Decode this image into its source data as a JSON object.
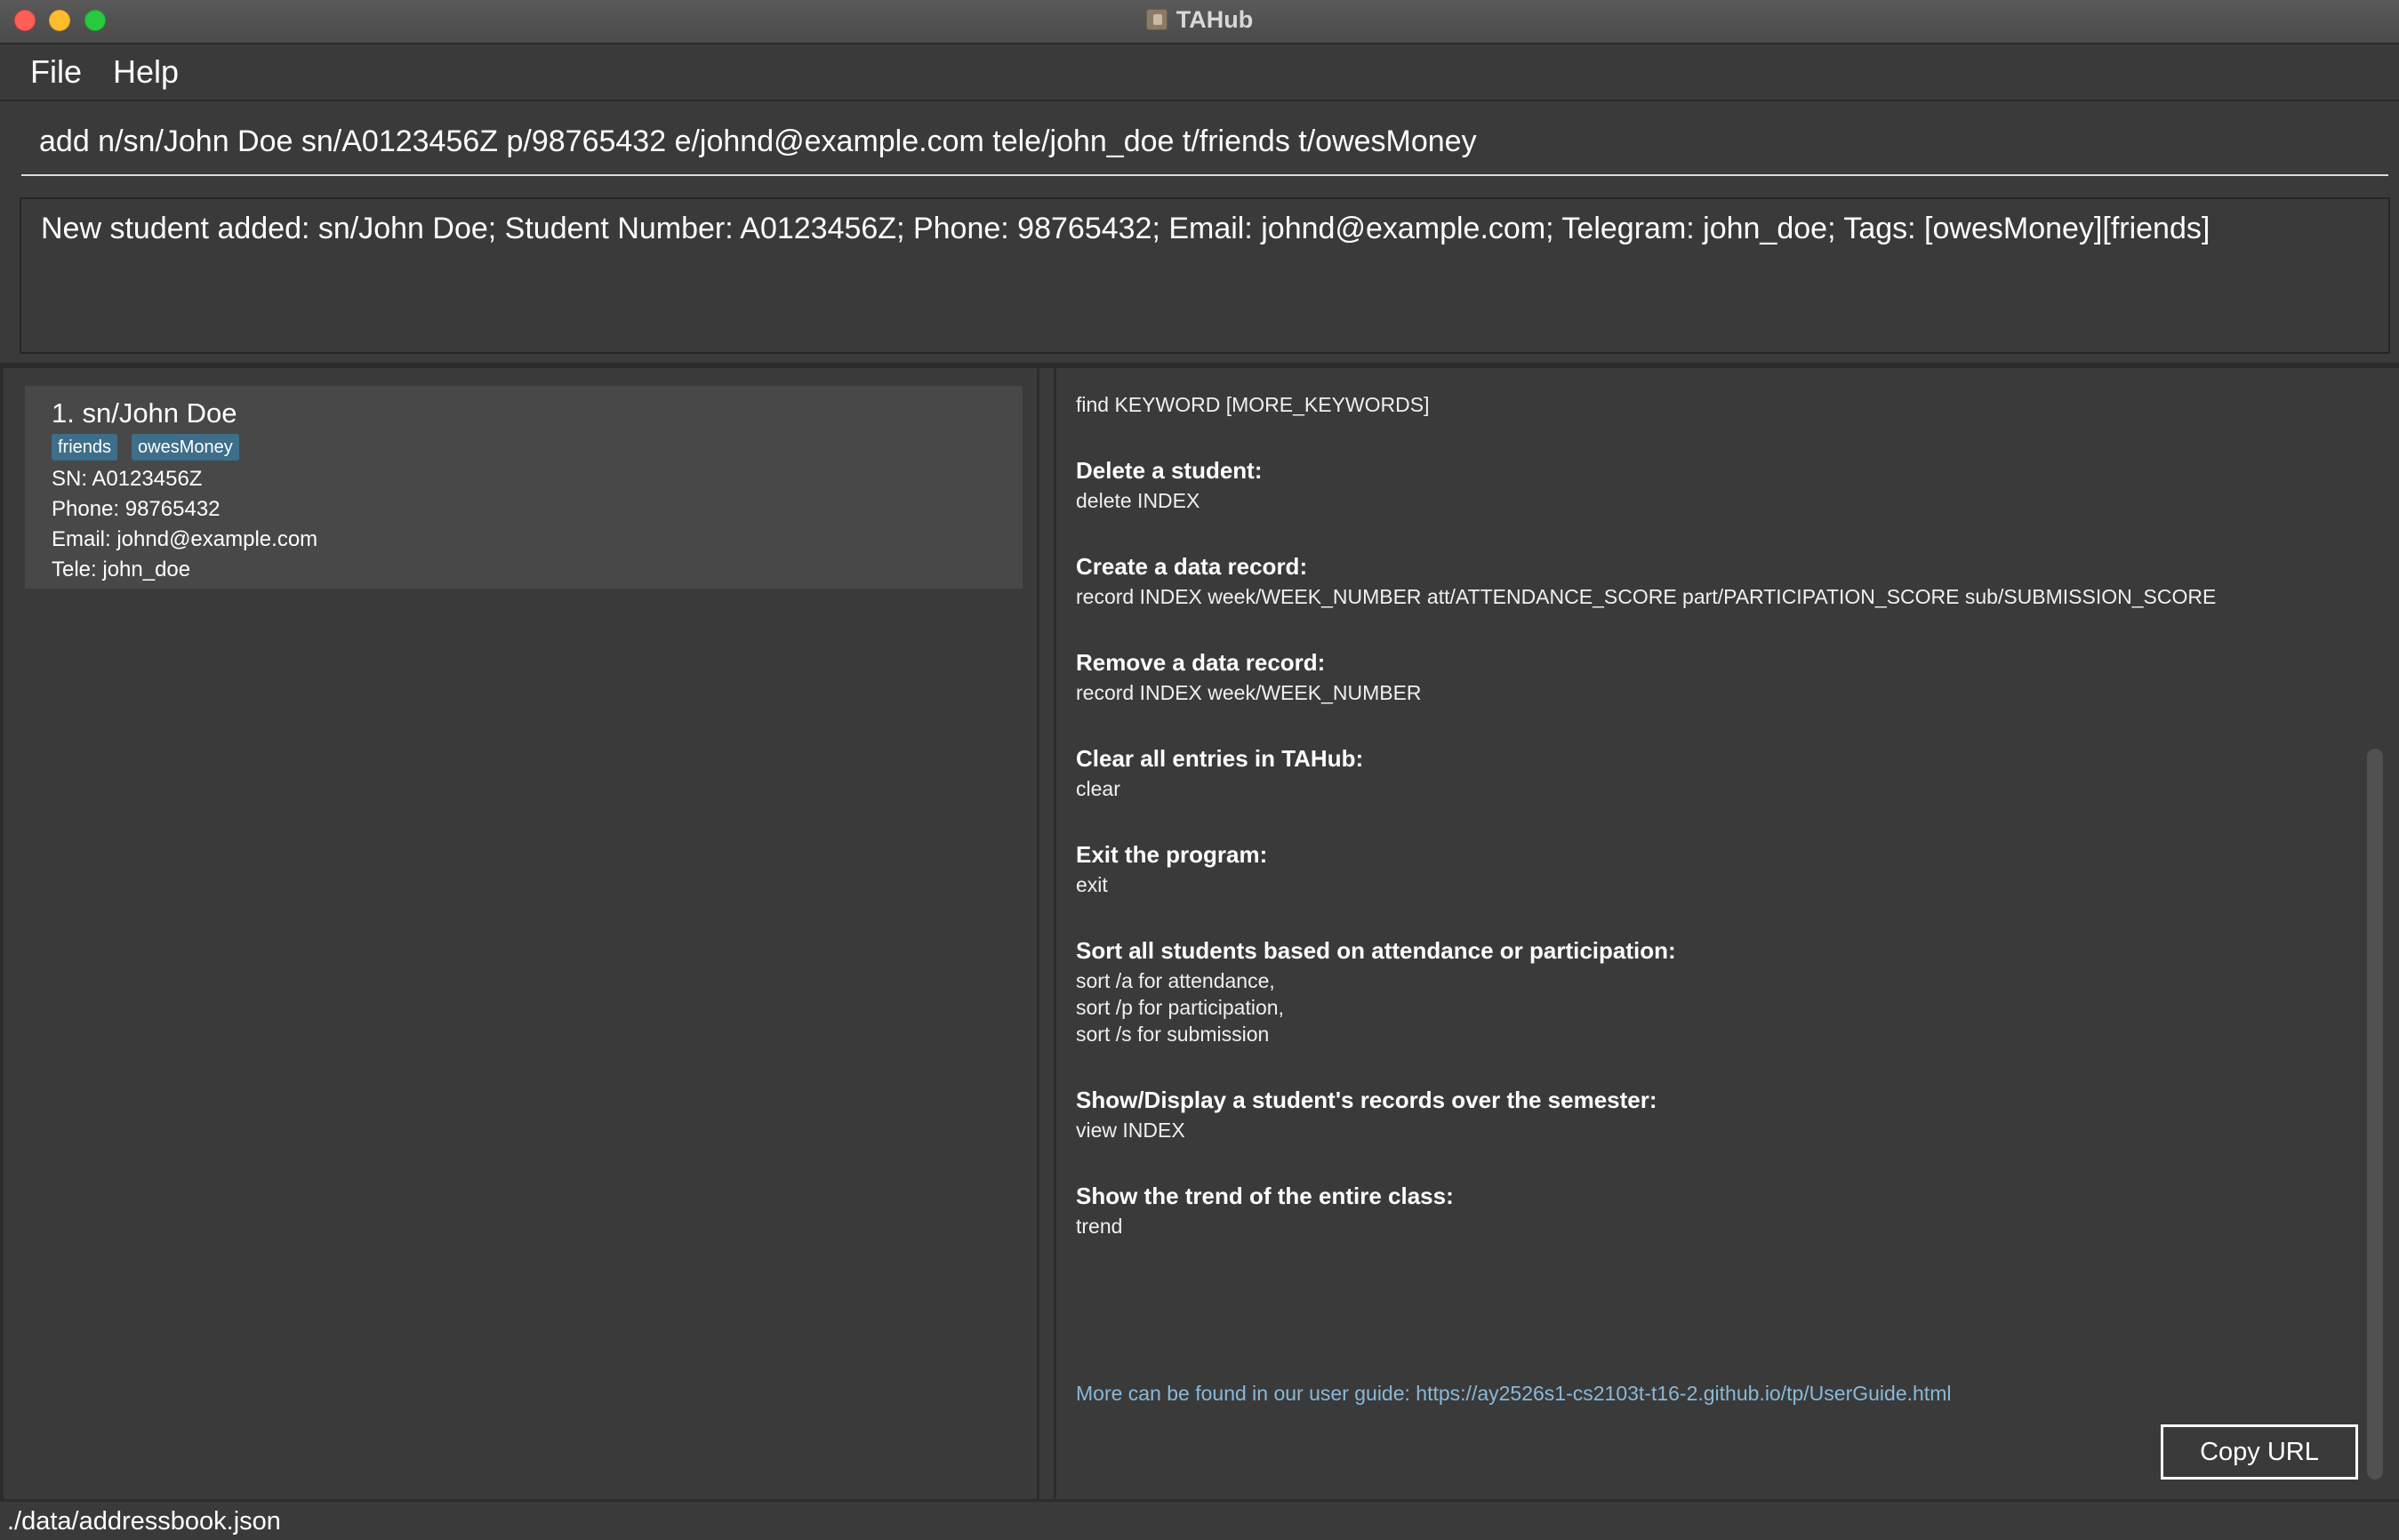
{
  "window": {
    "title": "TAHub"
  },
  "menu": {
    "file": "File",
    "help": "Help"
  },
  "command_box": {
    "value": "add n/sn/John Doe sn/A0123456Z p/98765432 e/johnd@example.com tele/john_doe t/friends t/owesMoney"
  },
  "result_display": {
    "text": "New student added: sn/John Doe; Student Number: A0123456Z; Phone: 98765432; Email: johnd@example.com; Telegram: john_doe; Tags: [owesMoney][friends]"
  },
  "students": [
    {
      "name": "1. sn/John Doe",
      "tags": [
        "friends",
        "owesMoney"
      ],
      "sn": "SN: A0123456Z",
      "phone": "Phone: 98765432",
      "email": "Email: johnd@example.com",
      "tele": "Tele: john_doe"
    }
  ],
  "help": {
    "find_cmd": "find KEYWORD [MORE_KEYWORDS]",
    "sections": [
      {
        "title": "Delete a student:",
        "cmd": "delete INDEX"
      },
      {
        "title": "Create a data record:",
        "cmd": "record INDEX week/WEEK_NUMBER att/ATTENDANCE_SCORE part/PARTICIPATION_SCORE sub/SUBMISSION_SCORE"
      },
      {
        "title": "Remove a data record:",
        "cmd": "record INDEX week/WEEK_NUMBER"
      },
      {
        "title": "Clear all entries in TAHub:",
        "cmd": "clear"
      },
      {
        "title": "Exit the program:",
        "cmd": "exit"
      },
      {
        "title": "Sort all students based on attendance or participation:",
        "cmd": "sort /a for attendance,\nsort /p for participation,\nsort /s for submission"
      },
      {
        "title": "Show/Display a student's records over the semester:",
        "cmd": "view INDEX"
      },
      {
        "title": "Show the trend of the entire class:",
        "cmd": "trend"
      }
    ],
    "guide": "More can be found in our user guide: https://ay2526s1-cs2103t-t16-2.github.io/tp/UserGuide.html",
    "copy_button": "Copy URL"
  },
  "status_bar": {
    "path": "./data/addressbook.json"
  },
  "colors": {
    "background": "#3a3a3a",
    "tag": "#3d6e8a",
    "guide_link": "#8ab8d8"
  }
}
